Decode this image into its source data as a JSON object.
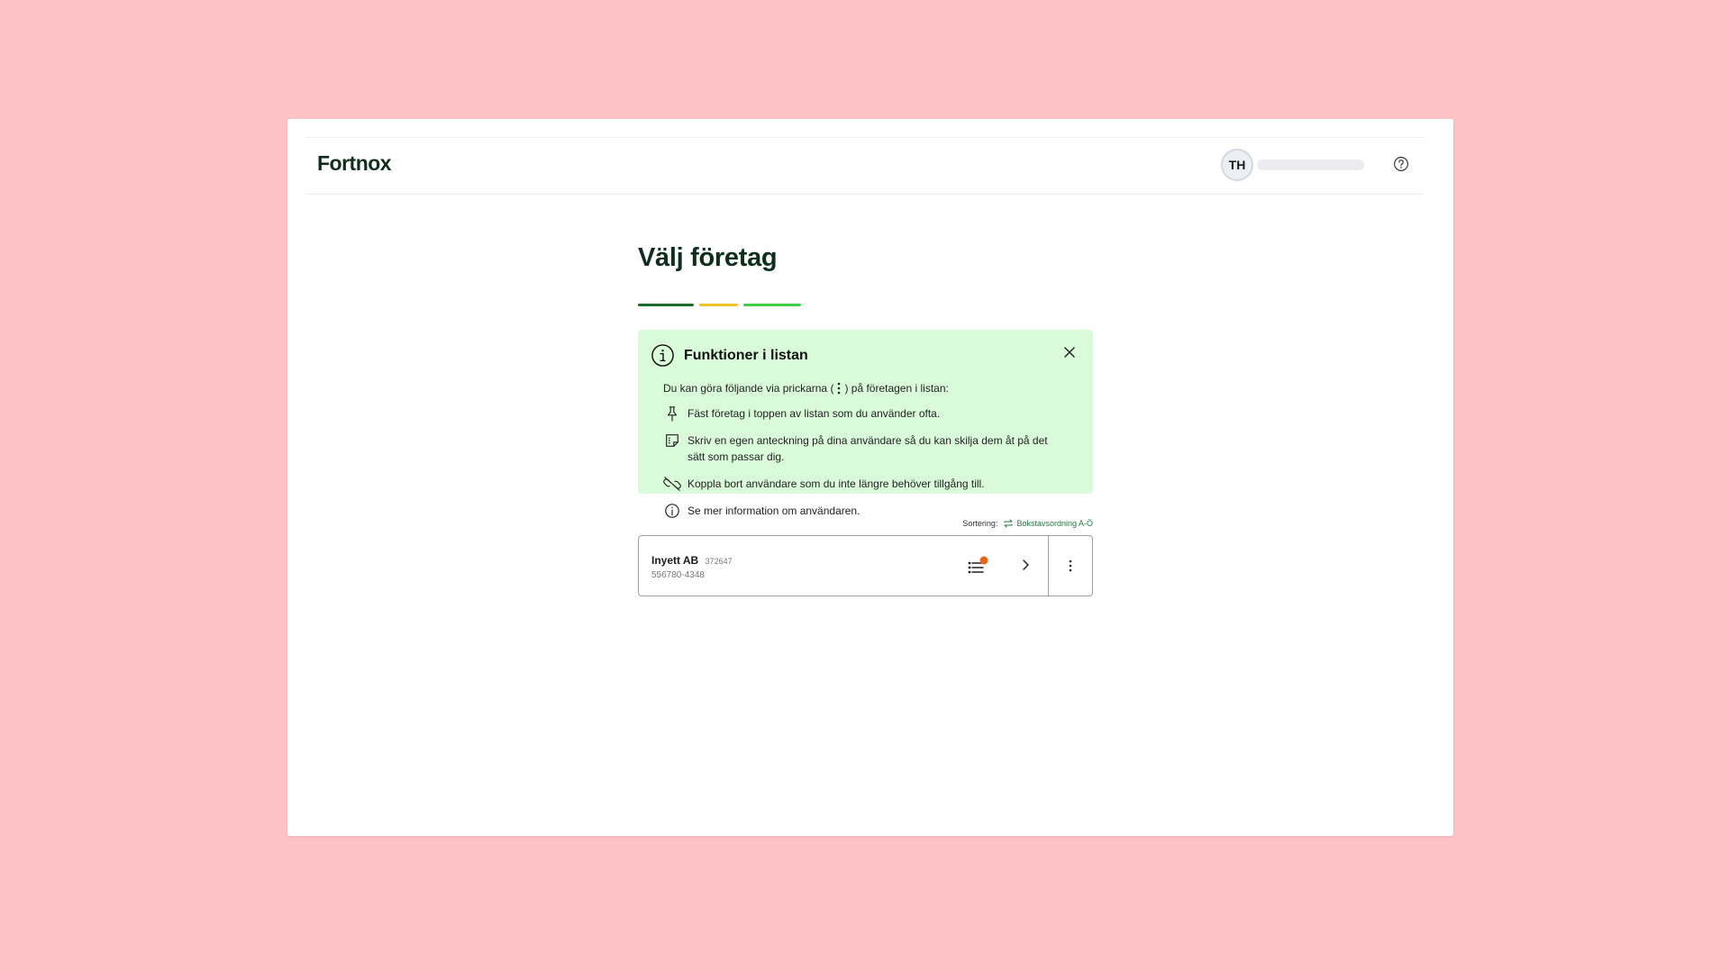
{
  "colors": {
    "background": "#fdc2c5",
    "brand_dark": "#0f2e1f",
    "info_bg": "#d9fbd9",
    "stripe_1": "#1a6e2a",
    "stripe_2": "#f2c12e",
    "stripe_3": "#3fce4f",
    "notification_dot": "#e8641a",
    "link_green": "#1f7a3d"
  },
  "header": {
    "logo_text": "Fortnox",
    "avatar_initials": "TH",
    "help_icon": "question-circle-icon"
  },
  "page": {
    "title": "Välj företag"
  },
  "info_box": {
    "title": "Funktioner i listan",
    "intro_before": "Du kan göra följande via prickarna (",
    "intro_after": ") på företagen i listan:",
    "features": [
      {
        "icon": "pin-icon",
        "text": "Fäst företag i toppen av listan som du använder ofta."
      },
      {
        "icon": "note-icon",
        "text": "Skriv en egen anteckning på dina användare så du kan skilja dem åt på det sätt som passar dig."
      },
      {
        "icon": "unlink-icon",
        "text": "Koppla bort användare som du inte längre behöver tillgång till."
      },
      {
        "icon": "info-icon",
        "text": "Se mer information om användaren."
      }
    ]
  },
  "sorting": {
    "label": "Sortering:",
    "value": "Bokstavsordning A-Ö"
  },
  "companies": [
    {
      "name": "Inyett AB",
      "customer_number": "372647",
      "org_number": "556780-4348"
    }
  ]
}
